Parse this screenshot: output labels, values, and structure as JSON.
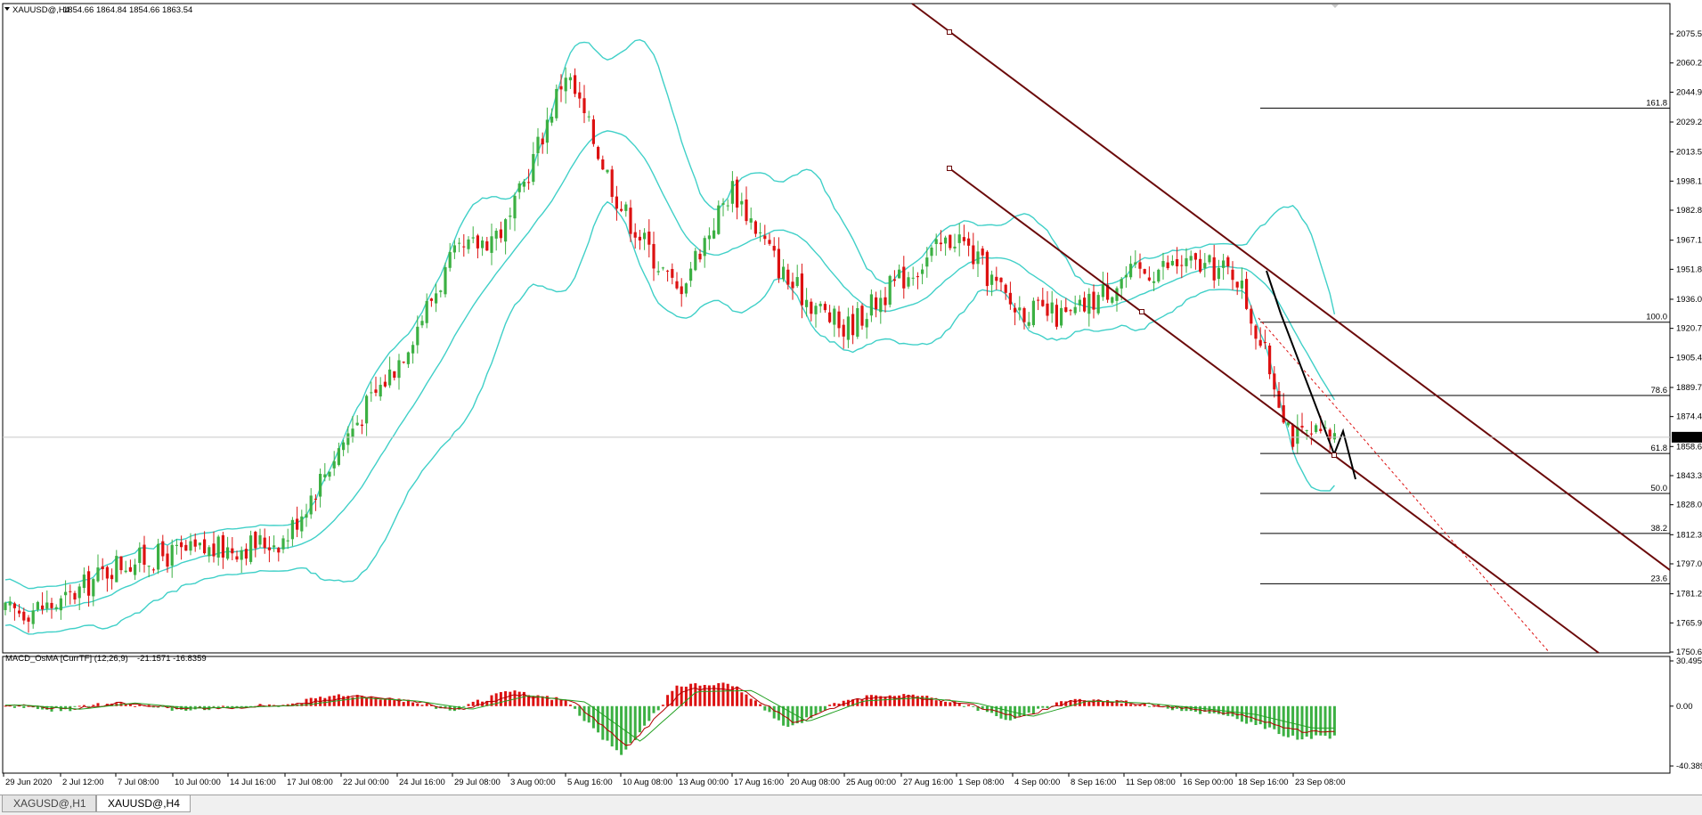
{
  "main_header": {
    "symbol": "XAUUSD@,H4",
    "ohlc": "1854.66 1864.84 1854.66 1863.54"
  },
  "price_axis": {
    "ticks": [
      "2075.55",
      "2060.25",
      "2044.90",
      "2029.20",
      "2013.55",
      "1998.15",
      "1982.85",
      "1967.10",
      "1951.80",
      "1936.05",
      "1920.75",
      "1905.45",
      "1889.70",
      "1874.40",
      "1858.65",
      "1843.35",
      "1828.05",
      "1812.30",
      "1797.00",
      "1781.25",
      "1765.95",
      "1750.65"
    ],
    "current_price": "1863.54"
  },
  "fib_labels": [
    "161.8",
    "100.0",
    "78.6",
    "61.8",
    "50.0",
    "38.2",
    "23.6"
  ],
  "osc_header": {
    "name": "MACD_OsMA [CurrTF] (12,26,9)",
    "values": "-21.1571 -16.8359"
  },
  "osc_axis": {
    "ticks": [
      "30.4954",
      "0.00",
      "-40.3896"
    ]
  },
  "time_axis": {
    "labels": [
      "29 Jun 2020",
      "2 Jul 12:00",
      "7 Jul 08:00",
      "10 Jul 00:00",
      "14 Jul 16:00",
      "17 Jul 08:00",
      "22 Jul 00:00",
      "24 Jul 16:00",
      "29 Jul 08:00",
      "3 Aug 00:00",
      "5 Aug 16:00",
      "10 Aug 08:00",
      "13 Aug 00:00",
      "17 Aug 16:00",
      "20 Aug 08:00",
      "25 Aug 00:00",
      "27 Aug 16:00",
      "1 Sep 08:00",
      "4 Sep 00:00",
      "8 Sep 16:00",
      "11 Sep 08:00",
      "16 Sep 00:00",
      "18 Sep 16:00",
      "23 Sep 08:00"
    ]
  },
  "tabs": [
    {
      "label": "XAGUSD@,H1",
      "active": false
    },
    {
      "label": "XAUUSD@,H4",
      "active": true
    }
  ],
  "colors": {
    "bull": "#3cb043",
    "bear": "#dd1111",
    "bands": "#40d0c8",
    "channel": "#6b0a0a",
    "macd_line": "#b00000",
    "signal_line": "#22a022"
  },
  "chart_data": [
    {
      "type": "candlestick",
      "title": "XAUUSD@,H4",
      "ylim": [
        1750.65,
        2075.55
      ],
      "close_path": [
        {
          "x": "29 Jun 2020",
          "y": 1771
        },
        {
          "x": "2 Jul 12:00",
          "y": 1776
        },
        {
          "x": "7 Jul 08:00",
          "y": 1797
        },
        {
          "x": "10 Jul 00:00",
          "y": 1802
        },
        {
          "x": "14 Jul 16:00",
          "y": 1805
        },
        {
          "x": "17 Jul 08:00",
          "y": 1810
        },
        {
          "x": "22 Jul 00:00",
          "y": 1860
        },
        {
          "x": "24 Jul 16:00",
          "y": 1903
        },
        {
          "x": "29 Jul 08:00",
          "y": 1957
        },
        {
          "x": "3 Aug 00:00",
          "y": 1975
        },
        {
          "x": "5 Aug 16:00",
          "y": 2056
        },
        {
          "x": "10 Aug 08:00",
          "y": 1985
        },
        {
          "x": "13 Aug 00:00",
          "y": 1940
        },
        {
          "x": "17 Aug 16:00",
          "y": 1995
        },
        {
          "x": "20 Aug 08:00",
          "y": 1945
        },
        {
          "x": "25 Aug 00:00",
          "y": 1920
        },
        {
          "x": "27 Aug 16:00",
          "y": 1947
        },
        {
          "x": "1 Sep 08:00",
          "y": 1970
        },
        {
          "x": "4 Sep 00:00",
          "y": 1932
        },
        {
          "x": "8 Sep 16:00",
          "y": 1926
        },
        {
          "x": "11 Sep 08:00",
          "y": 1948
        },
        {
          "x": "16 Sep 00:00",
          "y": 1955
        },
        {
          "x": "18 Sep 16:00",
          "y": 1950
        },
        {
          "x": "23 Sep 08:00",
          "y": 1863.54
        }
      ],
      "fibonacci_levels": [
        {
          "label": "161.8",
          "value": 2036.5
        },
        {
          "label": "100.0",
          "value": 1924.0
        },
        {
          "label": "78.6",
          "value": 1885.5
        },
        {
          "label": "61.8",
          "value": 1855.0
        },
        {
          "label": "50.0",
          "value": 1834.0
        },
        {
          "label": "38.2",
          "value": 1813.0
        },
        {
          "label": "23.6",
          "value": 1786.5
        }
      ]
    },
    {
      "type": "bar",
      "title": "MACD_OsMA [CurrTF] (12,26,9)",
      "ylim": [
        -40.3896,
        30.4954
      ],
      "osma_path": [
        {
          "x": "29 Jun 2020",
          "y": 1
        },
        {
          "x": "2 Jul 12:00",
          "y": -3
        },
        {
          "x": "7 Jul 08:00",
          "y": 3
        },
        {
          "x": "10 Jul 00:00",
          "y": -2
        },
        {
          "x": "14 Jul 16:00",
          "y": -1
        },
        {
          "x": "17 Jul 08:00",
          "y": 1
        },
        {
          "x": "22 Jul 00:00",
          "y": 8
        },
        {
          "x": "24 Jul 16:00",
          "y": 5
        },
        {
          "x": "29 Jul 08:00",
          "y": -3
        },
        {
          "x": "3 Aug 00:00",
          "y": 10
        },
        {
          "x": "5 Aug 16:00",
          "y": 4
        },
        {
          "x": "10 Aug 08:00",
          "y": -34
        },
        {
          "x": "13 Aug 00:00",
          "y": 14
        },
        {
          "x": "17 Aug 16:00",
          "y": 15
        },
        {
          "x": "20 Aug 08:00",
          "y": -15
        },
        {
          "x": "25 Aug 00:00",
          "y": 5
        },
        {
          "x": "27 Aug 16:00",
          "y": 8
        },
        {
          "x": "1 Sep 08:00",
          "y": 3
        },
        {
          "x": "4 Sep 00:00",
          "y": -10
        },
        {
          "x": "8 Sep 16:00",
          "y": 5
        },
        {
          "x": "11 Sep 08:00",
          "y": 3
        },
        {
          "x": "16 Sep 00:00",
          "y": -2
        },
        {
          "x": "18 Sep 16:00",
          "y": -8
        },
        {
          "x": "23 Sep 08:00",
          "y": -21.1571
        }
      ]
    }
  ]
}
